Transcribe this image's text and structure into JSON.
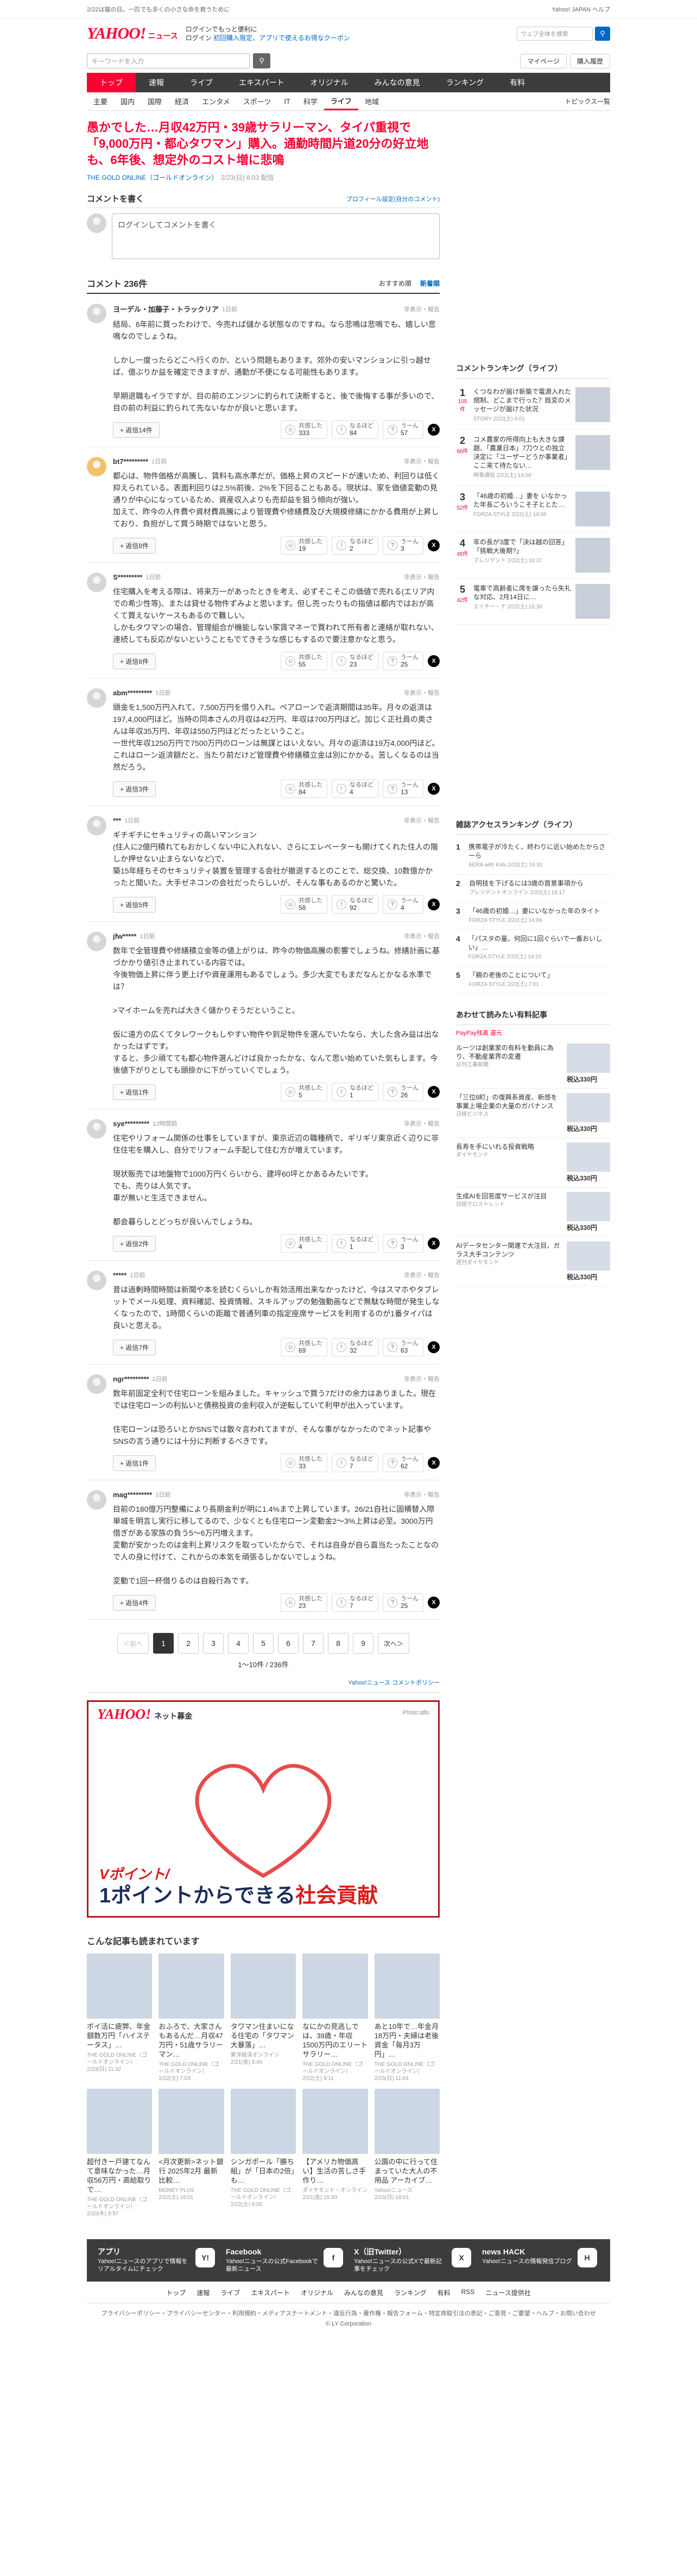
{
  "topbar": {
    "promo": "2/22は猫の日。一匹でも多くの小さな命を救うために",
    "right": "Yahoo! JAPAN  ヘルプ"
  },
  "header": {
    "logo": "YAHOO!",
    "logo_sub": "ニュース",
    "promo1": "ログインでもっと便利に",
    "promo2_plain": "ログイン",
    "promo2_link": "初回購入限定、アプリで使えるお得なクーポン",
    "search_placeholder": "ウェブ全体を検索",
    "login_btn": "ログイン"
  },
  "searchbar": {
    "placeholder": "キーワードを入力",
    "mypage": "マイページ",
    "purchase": "購入履歴"
  },
  "gnav": [
    "トップ",
    "速報",
    "ライブ",
    "エキスパート",
    "オリジナル",
    "みんなの意見",
    "ランキング",
    "有料"
  ],
  "snav": [
    "主要",
    "国内",
    "国際",
    "経済",
    "エンタメ",
    "スポーツ",
    "IT",
    "科学",
    "ライフ",
    "地域"
  ],
  "snav_topics": "トピックス一覧",
  "article": {
    "title": "愚かでした…月収42万円・39歳サラリーマン、タイパ重視で「9,000万円・都心タワマン」購入。通勤時間片道20分の好立地も、6年後、想定外のコスト増に悲鳴",
    "source": "THE GOLD ONLINE（ゴールドオンライン）",
    "date": "2/23(日) 8:03 配信"
  },
  "comment_write": {
    "heading": "コメントを書く",
    "policy": "プロフィール設定(自分のコメント)",
    "placeholder": "ログインしてコメントを書く"
  },
  "comments_head": {
    "count": "コメント 236件",
    "sort1": "おすすめ順",
    "sort2": "新着順"
  },
  "comments": [
    {
      "name": "ヨーデル・加藤子・トラックリア",
      "time": "1日前",
      "report": "非表示・報告",
      "text": "結局、6年前に買ったわけで、今売れば儲かる状態なのですね。なら悲鳴は悲鳴でも、嬉しい悲鳴なのでしょうね。\n\nしかし一度ったらどこへ行くのか、という問題もあります。郊外の安いマンションに引っ越せば、億ぶりか益を確定できますが、通勤が不便になる可能性もあります。\n\n早期退職もイラですが、目の前のエンジンに釣られて決断すると、後で後悔する事が多いので、目の前の利益に釣られて先ないなかが良いと思います。",
      "reply": "返信14件",
      "r1": "共感した",
      "n1": "333",
      "r2": "なるほど",
      "n2": "84",
      "r3": "うーん",
      "n3": "57"
    },
    {
      "name": "bt7*********",
      "time": "1日前",
      "report": "非表示・報告",
      "text": "都心は、物件価格が高騰し、賃料も高水準だが、価格上昇のスピードが速いため、利回りは低く抑えられている。表面利回りは2.5%前後、2%を下回ることもある。現状は、家を価値変動の見通りが中心になっているため、資産収入よりも売却益を狙う傾向が強い。\n加えて、昨今の人件費や資材費高騰により管理費や修繕費及び大規模修繕にかかる費用が上昇しており、負担がして買う時期ではないと思う。",
      "reply": "返信8件",
      "r1": "共感した",
      "n1": "19",
      "r2": "なるほど",
      "n2": "2",
      "r3": "うーん",
      "n3": "3"
    },
    {
      "name": "S*********",
      "time": "1日前",
      "report": "非表示・報告",
      "text": "住宅購入を考える際は、将来万一があったときを考え、必ずそこそこの価値で売れる(エリア内での希少性等)、または貸せる物件ずみよと思います。但し売ったりもの指値は都内ではおが高くて買えないケースもあるので難しい。\nしかもタワマンの場合、管理組合が機能しない家賃マネーで買われて所有者と連絡が取れない、連続しても反応がないということもでてきそうな感じもするので要注意かなと思う。",
      "reply": "返信6件",
      "r1": "共感した",
      "n1": "55",
      "r2": "なるほど",
      "n2": "23",
      "r3": "うーん",
      "n3": "25"
    },
    {
      "name": "abm*********",
      "time": "1日前",
      "report": "非表示・報告",
      "text": "頭金を1,500万円入れて、7,500万円を借り入れ。ペアローンで返済期間は35年。月々の返済は197,4,000円ほど。当時の同本さんの月収は42万円、年収は700万円ほど。加じく正社員の奥さんは年収35万円、年収は550万円ほどだったということ。\n一世代年収1250万円で7500万円のローンは無謀とはいえない。月々の返済は19万4,000円ほど。これはローン返済額だと、当たり前だけど管理費や修繕積立金は別にかかる。苦しくなるのは当然だろう。",
      "reply": "返信3件",
      "r1": "共感した",
      "n1": "84",
      "r2": "なるほど",
      "n2": "4",
      "r3": "うーん",
      "n3": "13"
    },
    {
      "name": "***",
      "time": "1日前",
      "report": "非表示・報告",
      "text": "ギチギチにセキュリティの高いマンション\n(住人に2億円積れてもおかしくない中に入れない、さらにエレベーターも開けてくれた住人の階しか押せない止まらないなど)で、\n築15年経ちそのセキュリティ装置を管理する会社が撤退するとのことで、総交換、10数億かかったと聞いた。大手ゼネコンの会社だったらしいが、そんな事もあるのかと驚いた。",
      "reply": "返信5件",
      "r1": "共感した",
      "n1": "58",
      "r2": "なるほど",
      "n2": "92",
      "r3": "うーん",
      "n3": "4"
    },
    {
      "name": "jfw*****",
      "time": "1日前",
      "report": "非表示・報告",
      "text": "数年で全管理費や修繕積立金等の値上がりは、昨今の物価高騰の影響でしょうね。修繕計画に基づかかり値引き止まれている内容では。\n今後物価上昇に伴う更上げや資産運用もあるでしょう。多少大変でもまだなんとかなる水準では？\n\n>マイホームを売れば大きく儲かりそうだということ。\n\n仮に遠方の広くてタレワークもしやすい物件や到足物件を選んでいたなら、大した含み益は出なかったはずです。\nすると、多少頑てても都心物件選んどけば良かったかな、なんて思い始めていた気もします。今後値下がりとしても頭掛かに下がっていくでしょう。",
      "reply": "返信1件",
      "r1": "共感した",
      "n1": "5",
      "r2": "なるほど",
      "n2": "1",
      "r3": "うーん",
      "n3": "26"
    },
    {
      "name": "sye*********",
      "time": "12時間前",
      "report": "非表示・報告",
      "text": "住宅やリフォーム関係の仕事をしていますが、東京近辺の職種柄で、ギリギリ東京近く辺りに非住住宅を購入し、自分でリフォーム手配して住む方が増えています。\n\n現状販売では地盤物で1000万円くらいから、建坪60坪とかあるみたいです。\nでも、売りは人気です。\n車が無いと生活できません。\n\n都会暮らしとどっちが良いんでしょうね。",
      "reply": "返信2件",
      "r1": "共感した",
      "n1": "4",
      "r2": "なるほど",
      "n2": "1",
      "r3": "うーん",
      "n3": "3"
    },
    {
      "name": "*****",
      "time": "1日前",
      "report": "非表示・報告",
      "text": "昔は過剰時間時間は新聞や本を読むくらいしか有効活用出来なかったけど、今はスマホやタブレットでメール処理、資料確認、投資情報、スキルアップの勉強動画などで無駄な時間が発生しなくなったので、1時間くらいの距離で普通列車の指定座席サービスを利用するのが1番タイパは良いと思える。",
      "reply": "返信7件",
      "r1": "共感した",
      "n1": "69",
      "r2": "なるほど",
      "n2": "32",
      "r3": "うーん",
      "n3": "63"
    },
    {
      "name": "ngr*********",
      "time": "1日前",
      "report": "非表示・報告",
      "text": "数年前固定全利で住宅ローンを組みました。キャッシュで買う7だけの余力はありました。現在では住宅ローンの利払いと債務投資の金利収入が逆転していて利甲が出入っています。\n\n住宅ローンは恐ろいとかSNSでは散々言われてますが、そんな事がなかったのでネット記事やSNSの言う通りには十分に判断するべきです。",
      "reply": "返信1件",
      "r1": "共感した",
      "n1": "33",
      "r2": "なるほど",
      "n2": "7",
      "r3": "うーん",
      "n3": "62"
    },
    {
      "name": "mag*********",
      "time": "1日前",
      "report": "非表示・報告",
      "text": "目前の180億万円整備により長期金利が明に1.4%まで上昇しています。26/21自社に固横替入際単城を明言し実行に移してるので、少なくとも住宅ローン変動金2～3%上昇は必至。3000万円借ぎがある家族の負う5～6万円増えます。\n変動が安かったのは金利上昇リスクを取っていたからで、それは自身が自ら直当たったことなので人の身に付けて、これからの本気を頑張るしかないでしょうね。\n\n変動で1回一杯借りるのは自殺行為です。",
      "reply": "返信4件",
      "r1": "共感した",
      "n1": "23",
      "r2": "なるほど",
      "n2": "7",
      "r3": "うーん",
      "n3": "25"
    }
  ],
  "pager": {
    "prev": "＜前へ",
    "next": "次へ＞",
    "pages": [
      "1",
      "2",
      "3",
      "4",
      "5",
      "6",
      "7",
      "8",
      "9"
    ],
    "info": "1〜10件 / 236件"
  },
  "policy_link": "Yahoo!ニュース コメントポリシー",
  "ad": {
    "logo": "YAHOO!",
    "logo_sub": "ネット募金",
    "photo": "Photo:aflo",
    "slogan": "Vポイント/",
    "big1": "1ポイントからできる",
    "big2": "社会貢献"
  },
  "more": {
    "heading": "こんな記事も読まれています",
    "cards": [
      {
        "title": "ボイ活に疲弊、年金額数万円「ハイステータス」…",
        "src": "THE GOLD ONLINE（ゴールドオンライン）",
        "date": "2/23(日) 11:32"
      },
      {
        "title": "おふろで、大家さんもあるんだ…月収47万円・51歳サラリーマン…",
        "src": "THE GOLD ONLINE（ゴールドオンライン）",
        "date": "2/22(土) 7:03"
      },
      {
        "title": "タワマン住まいになる住宅の「タワマン大暴落」…",
        "src": "東洋経済オンライン",
        "date": "2/21(金) 5:46"
      },
      {
        "title": "なにかの見逃しでは、39歳・年収1500万円のエリートサラリー…",
        "src": "THE GOLD ONLINE（ゴールドオンライン）",
        "date": "2/22(土) 8:11"
      },
      {
        "title": "あと10年で…年金月18万円・夫婦は老後資金「毎月3万円」…",
        "src": "THE GOLD ONLINE（ゴールドオンライン）",
        "date": "2/23(日) 11:04"
      },
      {
        "title": "超付きー戸建てなんて意味なかった…月収56万円・高給取りで…",
        "src": "THE GOLD ONLINE（ゴールドオンライン）",
        "date": "2/20(木) 8:57"
      },
      {
        "title": "<月次更新>ネット銀行 2025年2月 最新比較…",
        "src": "MONEY PLUS",
        "date": "2/22(土) 16:01"
      },
      {
        "title": "シンガポール「勝ち組」が「日本の2倍」も…",
        "src": "THE GOLD ONLINE（ゴールドオンライン）",
        "date": "2/22(土) 8:05"
      },
      {
        "title": "【アメリカ物価高い】生活の苦しさ手作り…",
        "src": "ダイヤモンド・オンライン",
        "date": "2/21(金) 15:50"
      },
      {
        "title": "公園の中に行って住まっていた大人の不用品 アーカイブ…",
        "src": "Yahoo!ニュース",
        "date": "2/23(日) 18:01"
      }
    ]
  },
  "side_ranking": {
    "heading": "コメントランキング（ライフ）",
    "items": [
      {
        "no": "1",
        "cnt": "105件",
        "title": "くつなわが届け新築で電源入れた規制、どこまで行った？既変のメッセージが届けた状況",
        "src": "STORY",
        "date": "2/22(土) 6:01"
      },
      {
        "no": "2",
        "cnt": "66件",
        "title": "コメ農家の所得向上も大きな課題、「農業日本」7刀ウとの独立決定に「ユーザーどうか事業者」ここ来て待たない…",
        "src": "時事通信",
        "date": "2/22(土) 14:00"
      },
      {
        "no": "3",
        "cnt": "52件",
        "title": "「46歳の初婚…」妻を いなかった年長ごろいうこそ子ととた…",
        "src": "FORZA STYLE",
        "date": "2/22(土) 14:06"
      },
      {
        "no": "4",
        "cnt": "45件",
        "title": "年の長が3度で「決は越の回答」「挑戦大後期?」",
        "src": "プレジデント",
        "date": "2/22(土) 16:37"
      },
      {
        "no": "5",
        "cnt": "42件",
        "title": "電車で高齢者に席を譲ったら失礼な対応、2月14日に…",
        "src": "エイチー・ナ",
        "date": "2/22(土) 15:30"
      }
    ]
  },
  "side_access": {
    "heading": "雑誌アクセスランキング（ライフ）",
    "items": [
      {
        "no": "1",
        "title": "携帯電子が冷たく、終わりに近い始めたからさーら",
        "src": "AERA with Kids",
        "date": "2/22(土) 16:31"
      },
      {
        "no": "2",
        "title": "自明技を下げるには3歳の首意事項から",
        "src": "プレジデントオンライン",
        "date": "2/22(土) 18:17"
      },
      {
        "no": "3",
        "title": "「46歳の初婚…」妻にいなかった年のタイト",
        "src": "FORZA STYLE",
        "date": "2/22(土) 14:06"
      },
      {
        "no": "4",
        "title": "「パスタの量、何回に1回ぐらいで一番おいしい」…",
        "src": "FORZA STYLE",
        "date": "2/22(土) 14:10"
      },
      {
        "no": "5",
        "title": "「親の老後のことについて」",
        "src": "FORZA STYLE",
        "date": "2/22(土) 7:01"
      }
    ]
  },
  "side_products": {
    "heading": "あわせて読みたい有料記事",
    "label": "PayPay残高 還元",
    "items": [
      {
        "title": "ルーツは創業家の有料を動員に為り、不動産業界の変遷",
        "src": "日刊工業新聞",
        "price": "税込330円"
      },
      {
        "title": "「三位8町」の復興系資産、新感を事業上場企業の大量のガバナンス",
        "src": "日経ビジネス",
        "price": "税込330円"
      },
      {
        "title": "長寿を手にいれる投資戦略",
        "src": "ダイヤモンド",
        "price": "税込330円"
      },
      {
        "title": "生成AIを回答度サービスが注目",
        "src": "日経クロストレンド",
        "price": "税込330円"
      },
      {
        "title": "AIデータセンター関連で大注目、ガラス大手コンテンツ",
        "src": "週刊ダイヤモンド",
        "price": "税込330円"
      }
    ]
  },
  "footer": {
    "apps": [
      {
        "title": "アプリ",
        "desc": "Yahoo!ニュースのアプリで情報をリアルタイムにチェック",
        "icon": "Y!"
      },
      {
        "title": "Facebook",
        "desc": "Yahoo!ニュースの公式Facebookで最新ニュース",
        "icon": "f"
      },
      {
        "title": "X（旧Twitter）",
        "desc": "Yahoo!ニュースの公式Xで最新記事をチェック",
        "icon": "X"
      },
      {
        "title": "news HACK",
        "desc": "Yahoo!ニュースの情報発信ブログ",
        "icon": "H"
      }
    ],
    "nav": [
      "トップ",
      "速報",
      "ライブ",
      "エキスパート",
      "オリジナル",
      "みんなの意見",
      "ランキング",
      "有料",
      "RSS",
      "ニュース提供社"
    ],
    "links": "プライバシーポリシー・プライバシーセンター・利用規約・メディアステートメント・違反行為・著作権・報告フォーム・特定商取引法の表記・ご意見・ご要望・ヘルプ・お問い合わせ",
    "copyright": "© LY Corporation"
  }
}
